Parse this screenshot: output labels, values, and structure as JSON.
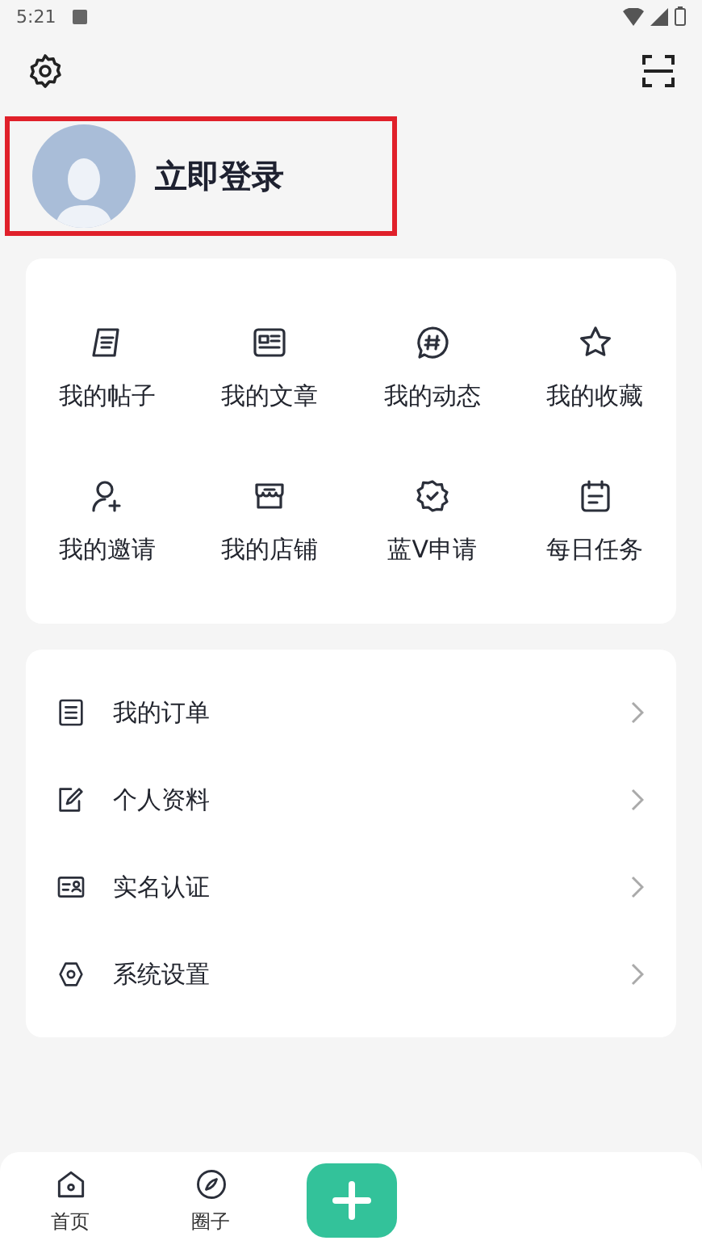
{
  "status_bar": {
    "time": "5:21"
  },
  "profile": {
    "login_label": "立即登录",
    "highlighted": true
  },
  "shortcuts": [
    {
      "label": "我的帖子"
    },
    {
      "label": "我的文章"
    },
    {
      "label": "我的动态"
    },
    {
      "label": "我的收藏"
    },
    {
      "label": "我的邀请"
    },
    {
      "label": "我的店铺"
    },
    {
      "label": "蓝V申请"
    },
    {
      "label": "每日任务"
    }
  ],
  "menu": [
    {
      "label": "我的订单"
    },
    {
      "label": "个人资料"
    },
    {
      "label": "实名认证"
    },
    {
      "label": "系统设置"
    }
  ],
  "bottom_nav": [
    {
      "label": "首页"
    },
    {
      "label": "圈子"
    }
  ]
}
